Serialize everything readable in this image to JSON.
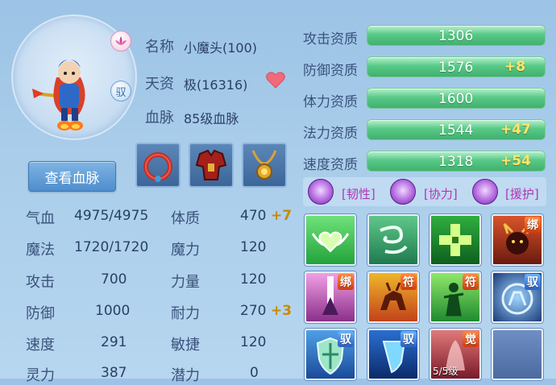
{
  "pet": {
    "name_label": "名称",
    "name_value": "小魔头(100)",
    "talent_label": "天资",
    "talent_value": "极(16316)",
    "bloodline_label": "血脉",
    "bloodline_value": "85级血脉",
    "lotus_icon": "lotus-icon",
    "control_badge": "驭",
    "heart_icon": "heart-icon",
    "heart_color": "#f06a7a"
  },
  "view_bloodline_button": "查看血脉",
  "equipment": [
    {
      "icon": "collar-icon"
    },
    {
      "icon": "armor-icon"
    },
    {
      "icon": "amulet-icon"
    }
  ],
  "stats": {
    "hp_label": "气血",
    "hp_value": "4975/4975",
    "mp_label": "魔法",
    "mp_value": "1720/1720",
    "atk_label": "攻击",
    "atk_value": "700",
    "def_label": "防御",
    "def_value": "1000",
    "spd_label": "速度",
    "spd_value": "291",
    "spirit_label": "灵力",
    "spirit_value": "387",
    "con_label": "体质",
    "con_value": "470",
    "con_bonus": "+7",
    "mag_label": "魔力",
    "mag_value": "120",
    "str_label": "力量",
    "str_value": "120",
    "end_label": "耐力",
    "end_value": "270",
    "end_bonus": "+3",
    "agi_label": "敏捷",
    "agi_value": "120",
    "pot_label": "潜力",
    "pot_value": "0"
  },
  "aptitudes": [
    {
      "label": "攻击资质",
      "value": "1306",
      "bonus": ""
    },
    {
      "label": "防御资质",
      "value": "1576",
      "bonus": "+8"
    },
    {
      "label": "体力资质",
      "value": "1600",
      "bonus": ""
    },
    {
      "label": "法力资质",
      "value": "1544",
      "bonus": "+47"
    },
    {
      "label": "速度资质",
      "value": "1318",
      "bonus": "+54"
    }
  ],
  "traits": [
    "[韧性]",
    "[协力]",
    "[援护]"
  ],
  "skills": {
    "badge_bind": "绑",
    "badge_fu": "符",
    "badge_yu": "驭",
    "badge_jue": "觉",
    "level_text": "5/5级"
  },
  "colors": {
    "aptitude_bar": "#58c987",
    "bonus": "#c98a00",
    "trait_text": "#b036b8"
  }
}
